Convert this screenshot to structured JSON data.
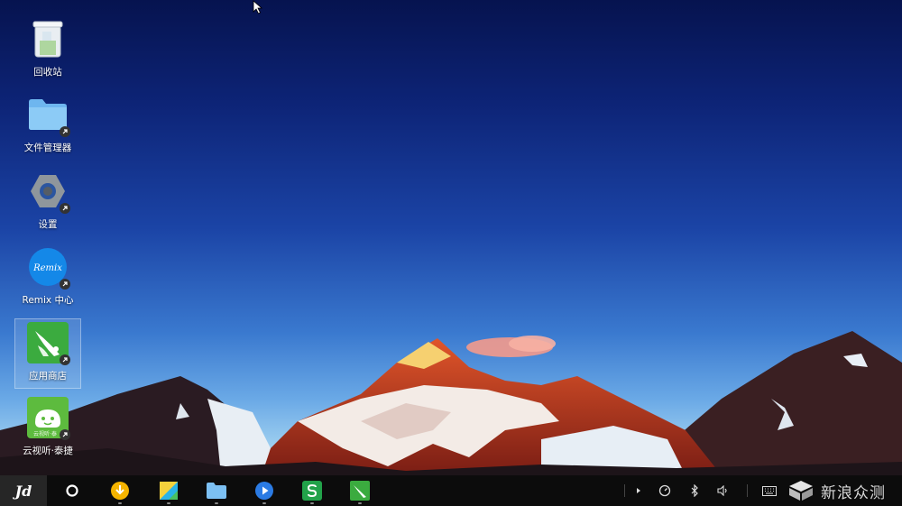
{
  "desktop": {
    "icons": [
      {
        "label": "回收站",
        "icon": "recycle-bin-icon"
      },
      {
        "label": "文件管理器",
        "icon": "folder-icon"
      },
      {
        "label": "设置",
        "icon": "settings-icon"
      },
      {
        "label": "Remix 中心",
        "icon": "remix-logo-icon",
        "logo_text": "Remix"
      },
      {
        "label": "应用商店",
        "icon": "app-store-icon"
      },
      {
        "label": "云视听·泰捷",
        "icon": "tv-app-icon",
        "sublabel": "云视听·泰"
      }
    ]
  },
  "taskbar": {
    "start_label": "Jide",
    "apps": [
      "search-circle-icon",
      "download-icon",
      "gallery-icon",
      "folder-icon",
      "video-player-icon",
      "spreadsheet-icon",
      "app-store-icon"
    ],
    "tray": [
      "expand-arrow-icon",
      "speed-gauge-icon",
      "bluetooth-icon",
      "volume-icon",
      "keyboard-icon"
    ]
  },
  "watermark": {
    "text": "新浪众测",
    "icon": "cube-logo-icon"
  },
  "colors": {
    "taskbar": "#0c0c0c",
    "start_button": "#262626",
    "sky_top": "#06134f",
    "sky_bottom": "#9ecff0"
  }
}
